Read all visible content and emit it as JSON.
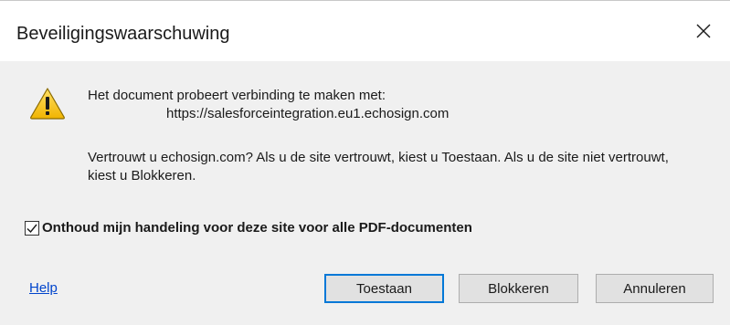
{
  "dialog": {
    "title": "Beveiligingswaarschuwing",
    "close_icon": "close-icon",
    "warning_icon": "warning-icon",
    "message": {
      "line1": "Het document probeert verbinding te maken met:",
      "url": "https://salesforceintegration.eu1.echosign.com",
      "question": "Vertrouwt u echosign.com? Als u de site vertrouwt, kiest u Toestaan. Als u de site niet vertrouwt, kiest u Blokkeren."
    },
    "remember": {
      "label": "Onthoud mijn handeling voor deze site voor alle PDF-documenten",
      "checked": true
    },
    "help_link": "Help",
    "buttons": {
      "allow": "Toestaan",
      "block": "Blokkeren",
      "cancel": "Annuleren"
    }
  },
  "colors": {
    "accent": "#0078d7",
    "link": "#0044cc",
    "warning_yellow": "#f5c000",
    "background": "#f0f0f0"
  }
}
